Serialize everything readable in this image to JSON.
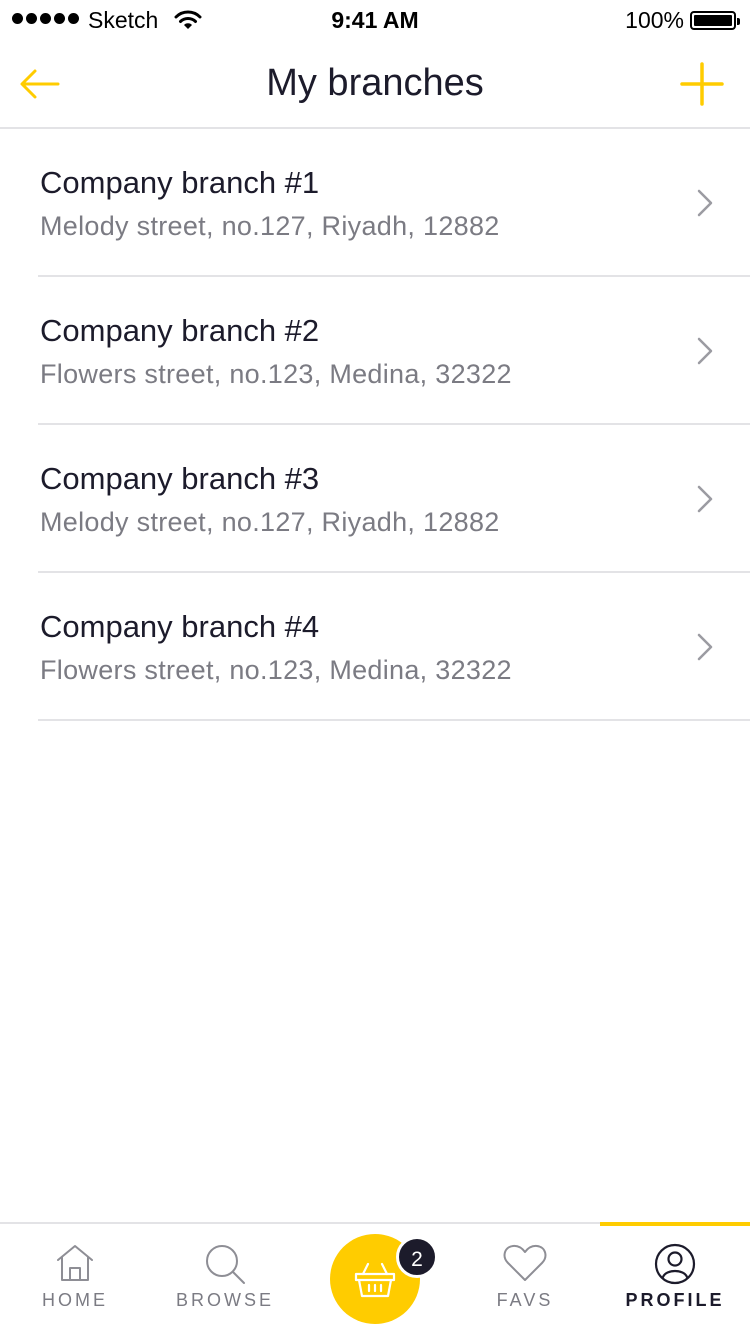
{
  "status_bar": {
    "carrier": "Sketch",
    "time": "9:41 AM",
    "battery": "100%"
  },
  "header": {
    "title": "My branches",
    "back_icon": "arrow-left-icon",
    "add_icon": "plus-icon"
  },
  "branches": [
    {
      "name": "Company branch #1",
      "address": "Melody street, no.127, Riyadh, 12882"
    },
    {
      "name": "Company branch #2",
      "address": "Flowers street, no.123, Medina, 32322"
    },
    {
      "name": "Company branch #3",
      "address": "Melody street, no.127, Riyadh, 12882"
    },
    {
      "name": "Company branch #4",
      "address": "Flowers street, no.123, Medina, 32322"
    }
  ],
  "tab_bar": {
    "tabs": [
      {
        "label": "HOME",
        "icon": "home-icon"
      },
      {
        "label": "BROWSE",
        "icon": "search-icon"
      },
      {
        "label": "FAVS",
        "icon": "heart-icon"
      },
      {
        "label": "PROFILE",
        "icon": "user-icon",
        "active": true
      }
    ],
    "cart": {
      "icon": "basket-icon",
      "badge": "2"
    }
  },
  "colors": {
    "accent": "#ffcc00",
    "text_primary": "#1c1b2b",
    "text_secondary": "#7b7b83",
    "divider": "#e3e3e6"
  }
}
